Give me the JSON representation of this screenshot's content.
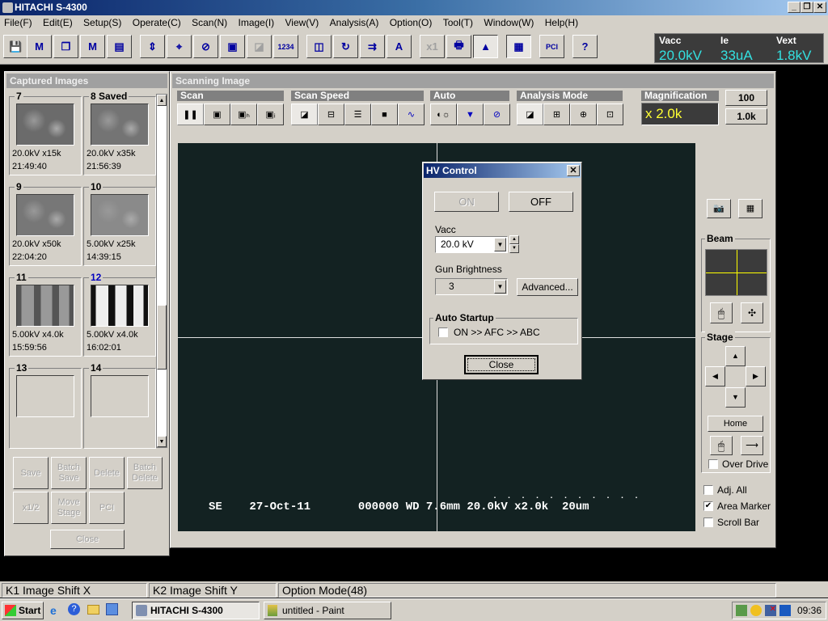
{
  "window": {
    "title": "HITACHI S-4300",
    "min": "_",
    "restore": "❐",
    "close": "✕"
  },
  "menu": [
    "File(F)",
    "Edit(E)",
    "Setup(S)",
    "Operate(C)",
    "Scan(N)",
    "Image(I)",
    "View(V)",
    "Analysis(A)",
    "Option(O)",
    "Tool(T)",
    "Window(W)",
    "Help(H)"
  ],
  "toolbar": {
    "buttons": [
      {
        "name": "save-icon",
        "glyph": "💾"
      },
      {
        "name": "memory-save-icon",
        "glyph": "M"
      },
      {
        "name": "cascade-windows-icon",
        "glyph": "❐"
      },
      {
        "name": "multi-memory-icon",
        "glyph": "M"
      },
      {
        "name": "document-icon",
        "glyph": "▤"
      },
      {
        "name": "align-icon",
        "glyph": "⇕"
      },
      {
        "name": "crosshair-icon",
        "glyph": "⌖"
      },
      {
        "name": "stigma-icon",
        "glyph": "⊘"
      },
      {
        "name": "window-layout-icon",
        "glyph": "▣"
      },
      {
        "name": "beam-icon",
        "glyph": "◪"
      },
      {
        "name": "data-display-icon",
        "glyph": "1234"
      },
      {
        "name": "dual-screen-icon",
        "glyph": "◫"
      },
      {
        "name": "rotate-icon",
        "glyph": "↻"
      },
      {
        "name": "signal-icon",
        "glyph": "⇉"
      },
      {
        "name": "annotate-icon",
        "glyph": "A"
      },
      {
        "name": "x1-icon",
        "glyph": "x1"
      },
      {
        "name": "print-icon",
        "glyph": "🖶"
      },
      {
        "name": "histogram-icon",
        "glyph": "▲"
      },
      {
        "name": "scan-window-icon",
        "glyph": "▦"
      },
      {
        "name": "pci-icon",
        "glyph": "PCI"
      },
      {
        "name": "help-icon",
        "glyph": "?"
      }
    ]
  },
  "readout": {
    "vacc_label": "Vacc",
    "vacc": "20.0kV",
    "ie_label": "Ie",
    "ie": "33uA",
    "vext_label": "Vext",
    "vext": "1.8kV"
  },
  "captured": {
    "title": "Captured Images",
    "items": [
      {
        "num": "7",
        "kv_mag": "20.0kV x15k",
        "time": "21:49:40",
        "tone": "#6b6b6b"
      },
      {
        "num": "8 Saved",
        "kv_mag": "20.0kV x35k",
        "time": "21:56:39",
        "tone": "#747474"
      },
      {
        "num": "9",
        "kv_mag": "20.0kV x50k",
        "time": "22:04:20",
        "tone": "#777777"
      },
      {
        "num": "10",
        "kv_mag": "5.00kV x25k",
        "time": "14:39:15",
        "tone": "#8a8a8a"
      },
      {
        "num": "11",
        "kv_mag": "5.00kV x4.0k",
        "time": "15:59:56",
        "tone": "#7a7a7a"
      },
      {
        "num": "12",
        "kv_mag": "5.00kV x4.0k",
        "time": "16:02:01",
        "tone": "#222222"
      },
      {
        "num": "13",
        "kv_mag": "",
        "time": "",
        "tone": ""
      },
      {
        "num": "14",
        "kv_mag": "",
        "time": "",
        "tone": ""
      }
    ],
    "buttons": {
      "save": "Save",
      "batch_save": "Batch Save",
      "delete": "Delete",
      "batch_delete": "Batch Delete",
      "half": "x1/2",
      "move_stage": "Move Stage",
      "pci": "PCI",
      "close": "Close"
    }
  },
  "scanning": {
    "title": "Scanning Image",
    "groups": {
      "scan": "Scan",
      "speed": "Scan Speed",
      "auto": "Auto",
      "analysis": "Analysis Mode",
      "magnification": "Magnification"
    },
    "magnification": "x 2.0k",
    "mag_presets": [
      "100",
      "1.0k"
    ],
    "overlay": {
      "detector": "SE",
      "date": "27-Oct-11",
      "number": "000000",
      "wd": "WD 7.6mm",
      "kv": "20.0kV",
      "mag": "x2.0k",
      "scale": "20um"
    }
  },
  "side": {
    "beam_label": "Beam",
    "stage_label": "Stage",
    "home": "Home",
    "over_drive": "Over Drive",
    "adj_all": "Adj. All",
    "area_marker": "Area Marker",
    "scroll_bar": "Scroll Bar",
    "over_drive_checked": false,
    "adj_all_checked": false,
    "area_marker_checked": true,
    "scroll_bar_checked": false
  },
  "hv": {
    "title": "HV Control",
    "on": "ON",
    "off": "OFF",
    "vacc_label": "Vacc",
    "vacc_value": "20.0 kV",
    "gun_label": "Gun Brightness",
    "gun_value": "3",
    "advanced": "Advanced...",
    "auto_startup": "Auto Startup",
    "auto_option": "ON >> AFC >> ABC",
    "auto_checked": false,
    "close": "Close"
  },
  "status": {
    "k1": "K1  Image Shift X",
    "k2": "K2  Image Shift Y",
    "mode": "Option Mode(48)"
  },
  "taskbar": {
    "start": "Start",
    "tasks": [
      "HITACHI S-4300",
      "untitled - Paint"
    ],
    "clock": "09:36"
  }
}
